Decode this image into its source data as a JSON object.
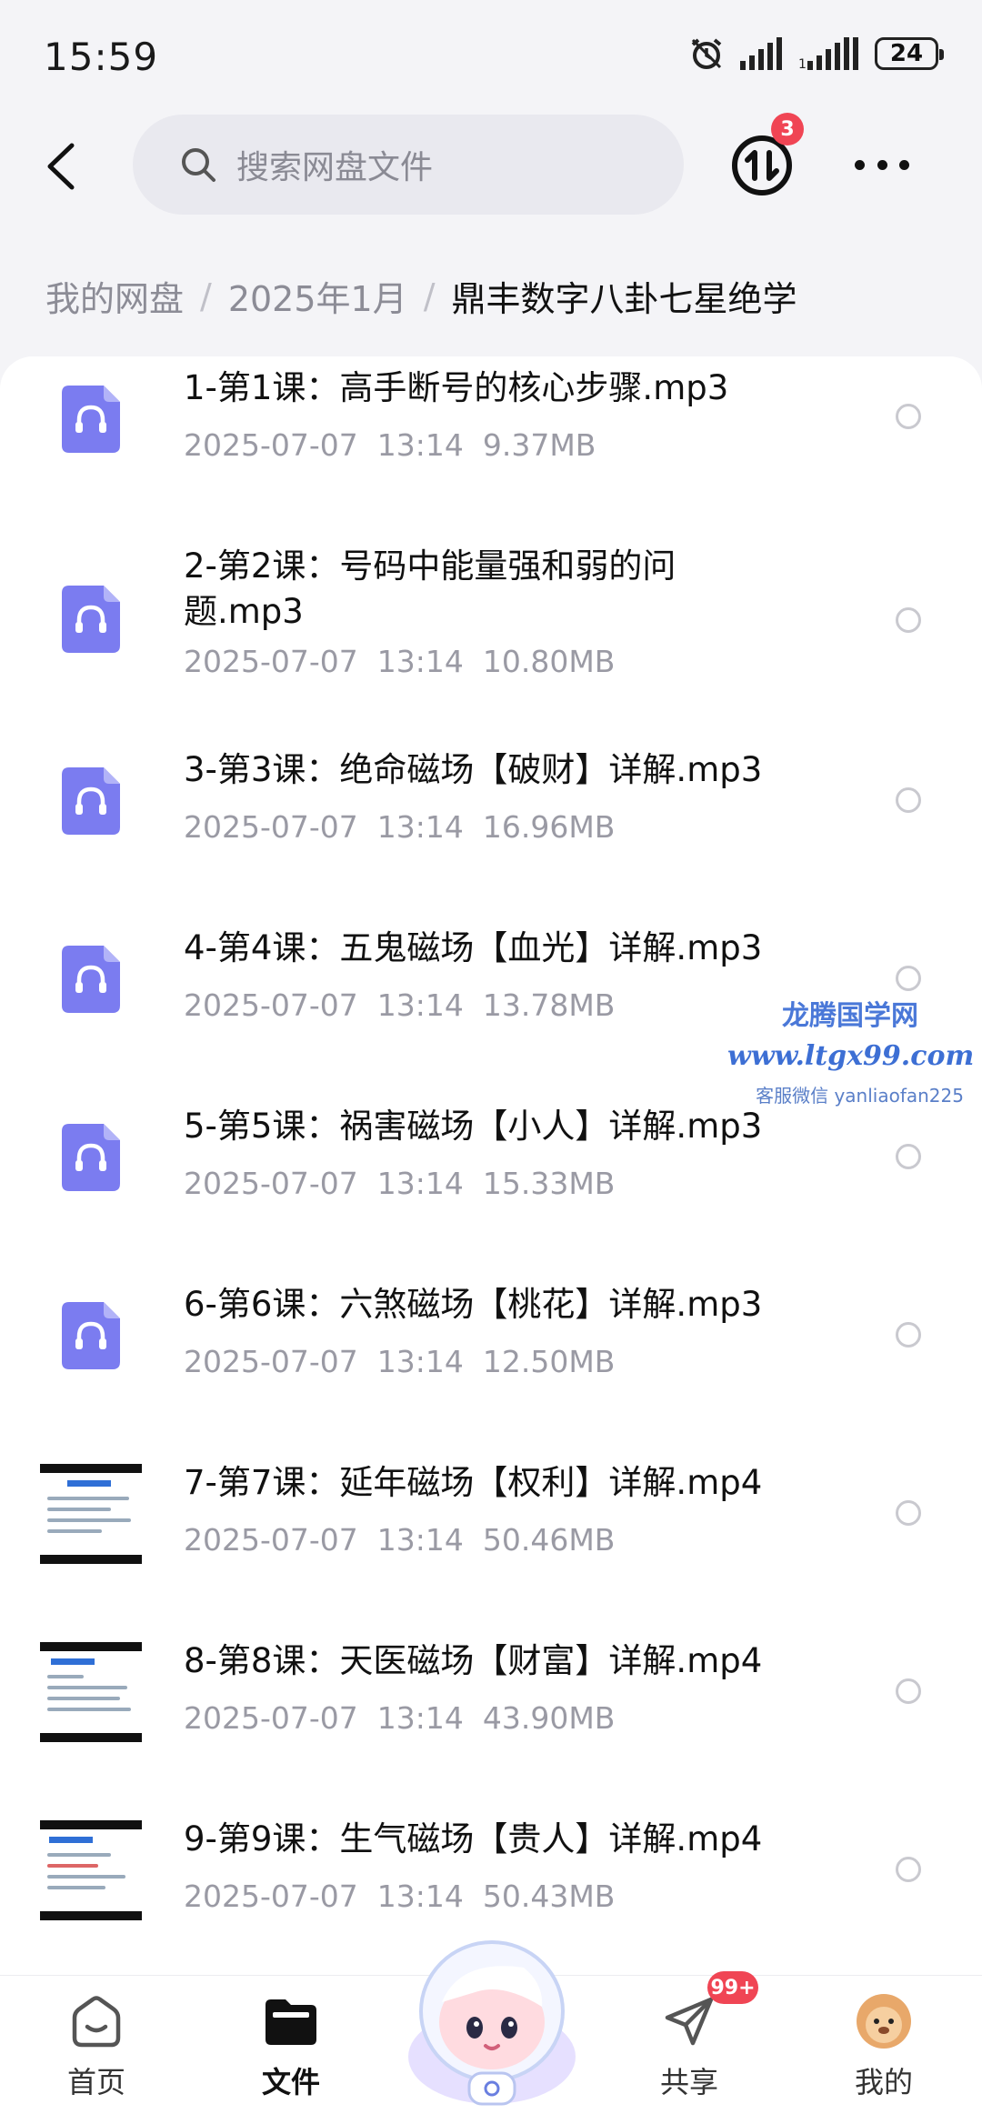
{
  "status_bar": {
    "time": "15:59",
    "battery": "24"
  },
  "header": {
    "search_placeholder": "搜索网盘文件",
    "transfer_badge": "3"
  },
  "breadcrumb": {
    "root": "我的网盘",
    "parent": "2025年1月",
    "current": "鼎丰数字八卦七星绝学"
  },
  "files": [
    {
      "name": "1-第1课：高手断号的核心步骤.mp3",
      "date": "2025-07-07",
      "time": "13:14",
      "size": "9.37MB",
      "type": "audio"
    },
    {
      "name": "2-第2课：号码中能量强和弱的问题.mp3",
      "date": "2025-07-07",
      "time": "13:14",
      "size": "10.80MB",
      "type": "audio"
    },
    {
      "name": "3-第3课：绝命磁场【破财】详解.mp3",
      "date": "2025-07-07",
      "time": "13:14",
      "size": "16.96MB",
      "type": "audio"
    },
    {
      "name": "4-第4课：五鬼磁场【血光】详解.mp3",
      "date": "2025-07-07",
      "time": "13:14",
      "size": "13.78MB",
      "type": "audio"
    },
    {
      "name": "5-第5课：祸害磁场【小人】详解.mp3",
      "date": "2025-07-07",
      "time": "13:14",
      "size": "15.33MB",
      "type": "audio"
    },
    {
      "name": "6-第6课：六煞磁场【桃花】详解.mp3",
      "date": "2025-07-07",
      "time": "13:14",
      "size": "12.50MB",
      "type": "audio"
    },
    {
      "name": "7-第7课：延年磁场【权利】详解.mp4",
      "date": "2025-07-07",
      "time": "13:14",
      "size": "50.46MB",
      "type": "video"
    },
    {
      "name": "8-第8课：天医磁场【财富】详解.mp4",
      "date": "2025-07-07",
      "time": "13:14",
      "size": "43.90MB",
      "type": "video"
    },
    {
      "name": "9-第9课：生气磁场【贵人】详解.mp4",
      "date": "2025-07-07",
      "time": "13:14",
      "size": "50.43MB",
      "type": "video"
    }
  ],
  "watermark": {
    "line1": "龙腾国学网",
    "line2": "www.ltgx99.com",
    "line3": "客服微信 yanliaofan225"
  },
  "bottom_nav": {
    "items": [
      {
        "label": "首页",
        "icon": "home-icon"
      },
      {
        "label": "文件",
        "icon": "folder-icon",
        "active": true
      },
      {
        "label": "共享",
        "icon": "share-icon",
        "badge": "99+"
      },
      {
        "label": "我的",
        "icon": "avatar"
      }
    ]
  },
  "colors": {
    "accent": "#7b7cf0",
    "badge": "#f04554",
    "meta": "#9a9aa4"
  }
}
